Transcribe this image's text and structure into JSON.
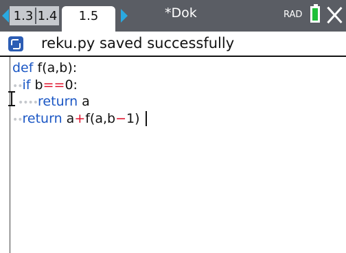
{
  "topbar": {
    "tabs": [
      "1.3",
      "1.4",
      "1.5"
    ],
    "active_tab": "1.5",
    "doc_title": "*Dok",
    "angle_mode": "RAD",
    "battery_color": "#1fbf3a",
    "accent": "#2aa9e0"
  },
  "status": {
    "icon": "python-icon",
    "message": "reku.py saved successfully"
  },
  "code": {
    "line1": "def f(a,b):",
    "line2_kw": "if",
    "line2_rest1": " b",
    "line2_op": "==",
    "line2_rest2": "0:",
    "line3_kw": "return",
    "line3_rest": " a",
    "line4_kw": "return",
    "line4_a": " a",
    "line4_plus": "+",
    "line4_mid": "f(a,b",
    "line4_minus": "−",
    "line4_end": "1)"
  }
}
